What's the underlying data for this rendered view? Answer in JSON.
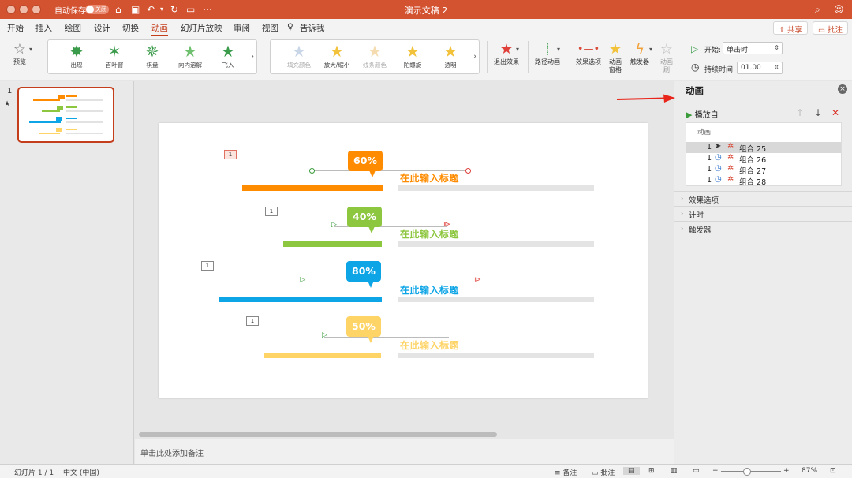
{
  "titlebar": {
    "autosave_label": "自动保存",
    "autosave_state": "关闭",
    "doc_title": "演示文稿 2"
  },
  "tabs": {
    "items": [
      "开始",
      "插入",
      "绘图",
      "设计",
      "切换",
      "动画",
      "幻灯片放映",
      "审阅",
      "视图"
    ],
    "active": "动画",
    "tell_me": "告诉我",
    "share": "共享",
    "comments": "批注"
  },
  "ribbon": {
    "preview": "预览",
    "entrance_effects": [
      "出现",
      "百叶窗",
      "棋盘",
      "向内溶解",
      "飞入"
    ],
    "emphasis_effects": [
      "填充颜色",
      "放大/缩小",
      "线条颜色",
      "陀螺旋",
      "透明"
    ],
    "exit_effects": "退出效果",
    "motion_paths": "路径动画",
    "effect_options": "效果选项",
    "animation_pane": "动画\n窗格",
    "trigger": "触发器",
    "animation_painter": "动画\n刷",
    "start_label": "开始:",
    "start_value": "单击时",
    "duration_label": "持续时间:",
    "duration_value": "01.00"
  },
  "thumbnails": {
    "slide_number": "1",
    "star": "★"
  },
  "slide": {
    "rows": [
      {
        "order": "1",
        "percent": "60%",
        "headline": "在此输入标题",
        "color": "#ff8c00"
      },
      {
        "order": "1",
        "percent": "40%",
        "headline": "在此输入标题",
        "color": "#8dc63f"
      },
      {
        "order": "1",
        "percent": "80%",
        "headline": "在此输入标题",
        "color": "#0ea5e6"
      },
      {
        "order": "1",
        "percent": "50%",
        "headline": "在此输入标题",
        "color": "#ffd466"
      }
    ]
  },
  "notes": {
    "placeholder": "单击此处添加备注"
  },
  "pane": {
    "title": "动画",
    "play_from": "播放自",
    "list_header": "动画",
    "items": [
      {
        "order": "1",
        "name": "组合 25"
      },
      {
        "order": "1",
        "name": "组合 26"
      },
      {
        "order": "1",
        "name": "组合 27"
      },
      {
        "order": "1",
        "name": "组合 28"
      }
    ],
    "sections": [
      "效果选项",
      "计时",
      "触发器"
    ]
  },
  "status": {
    "slide_counter": "幻灯片 1 / 1",
    "language": "中文 (中国)",
    "notes": "备注",
    "comments": "批注",
    "zoom": "87%"
  },
  "colors": {
    "accent": "#d35230",
    "arrow": "#e8251b"
  }
}
